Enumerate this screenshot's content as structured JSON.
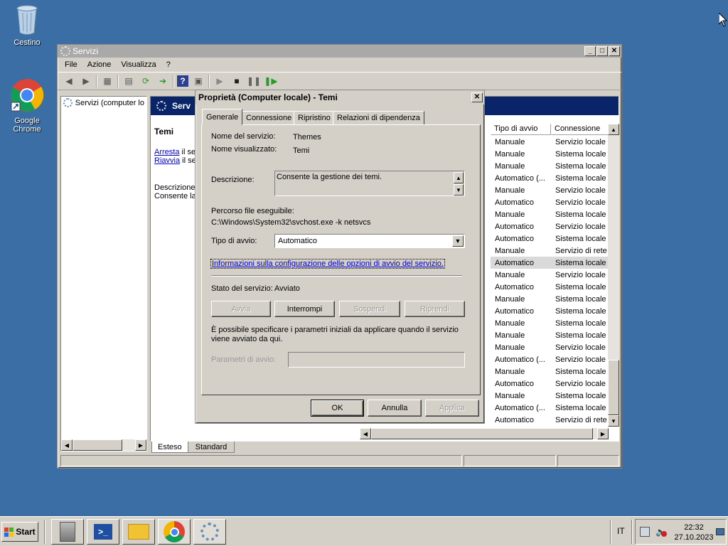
{
  "desktop": {
    "recycle_bin": "Cestino",
    "chrome": "Google Chrome"
  },
  "main_window": {
    "title": "Servizi",
    "menu": [
      "File",
      "Azione",
      "Visualizza",
      "?"
    ],
    "tree_item": "Servizi (computer lo",
    "header_title": "Serv",
    "detail": {
      "name": "Temi",
      "stop_link": "Arresta",
      "stop_suffix": " il se",
      "restart_link": "Riavvia",
      "restart_suffix": " il se",
      "desc_label": "Descrizione:",
      "desc_text": "Consente la"
    },
    "columns": [
      "Tipo di avvio",
      "Connessione"
    ],
    "rows": [
      [
        "Manuale",
        "Servizio locale"
      ],
      [
        "Manuale",
        "Sistema locale"
      ],
      [
        "Manuale",
        "Sistema locale"
      ],
      [
        "Automatico (...",
        "Sistema locale"
      ],
      [
        "Manuale",
        "Servizio locale"
      ],
      [
        "Automatico",
        "Servizio locale"
      ],
      [
        "Manuale",
        "Sistema locale"
      ],
      [
        "Automatico",
        "Servizio locale"
      ],
      [
        "Automatico",
        "Sistema locale"
      ],
      [
        "Manuale",
        "Servizio di rete"
      ],
      [
        "Automatico",
        "Sistema locale"
      ],
      [
        "Manuale",
        "Servizio locale"
      ],
      [
        "Automatico",
        "Sistema locale"
      ],
      [
        "Manuale",
        "Sistema locale"
      ],
      [
        "Automatico",
        "Sistema locale"
      ],
      [
        "Manuale",
        "Sistema locale"
      ],
      [
        "Manuale",
        "Sistema locale"
      ],
      [
        "Manuale",
        "Servizio locale"
      ],
      [
        "Automatico (...",
        "Servizio locale"
      ],
      [
        "Manuale",
        "Sistema locale"
      ],
      [
        "Automatico",
        "Servizio locale"
      ],
      [
        "Manuale",
        "Sistema locale"
      ],
      [
        "Automatico (...",
        "Sistema locale"
      ],
      [
        "Automatico",
        "Servizio di rete"
      ]
    ],
    "bottom_tabs": [
      "Esteso",
      "Standard"
    ]
  },
  "dialog": {
    "title": "Proprietà (Computer locale) - Temi",
    "tabs": [
      "Generale",
      "Connessione",
      "Ripristino",
      "Relazioni di dipendenza"
    ],
    "service_name_label": "Nome del servizio:",
    "service_name": "Themes",
    "display_name_label": "Nome visualizzato:",
    "display_name": "Temi",
    "description_label": "Descrizione:",
    "description": "Consente la gestione dei temi.",
    "path_label": "Percorso file eseguibile:",
    "path": "C:\\Windows\\System32\\svchost.exe -k netsvcs",
    "startup_label": "Tipo di avvio:",
    "startup_value": "Automatico",
    "help_link": "Informazioni sulla configurazione delle opzioni di avvio del servizio.",
    "status_label": "Stato del servizio:",
    "status_value": "Avviato",
    "btn_start": "Avvia",
    "btn_stop": "Interrompi",
    "btn_pause": "Sospendi",
    "btn_resume": "Riprendi",
    "params_note": "È possibile specificare i parametri iniziali da applicare quando il servizio viene avviato da qui.",
    "params_label": "Parametri di avvio:",
    "ok": "OK",
    "cancel": "Annulla",
    "apply": "Applica"
  },
  "taskbar": {
    "start": "Start",
    "lang": "IT",
    "time": "22:32",
    "date": "27.10.2023"
  },
  "colors": {
    "desktop": "#3a6ea5",
    "link": "#0000cc",
    "header_band": "#0a246a"
  }
}
